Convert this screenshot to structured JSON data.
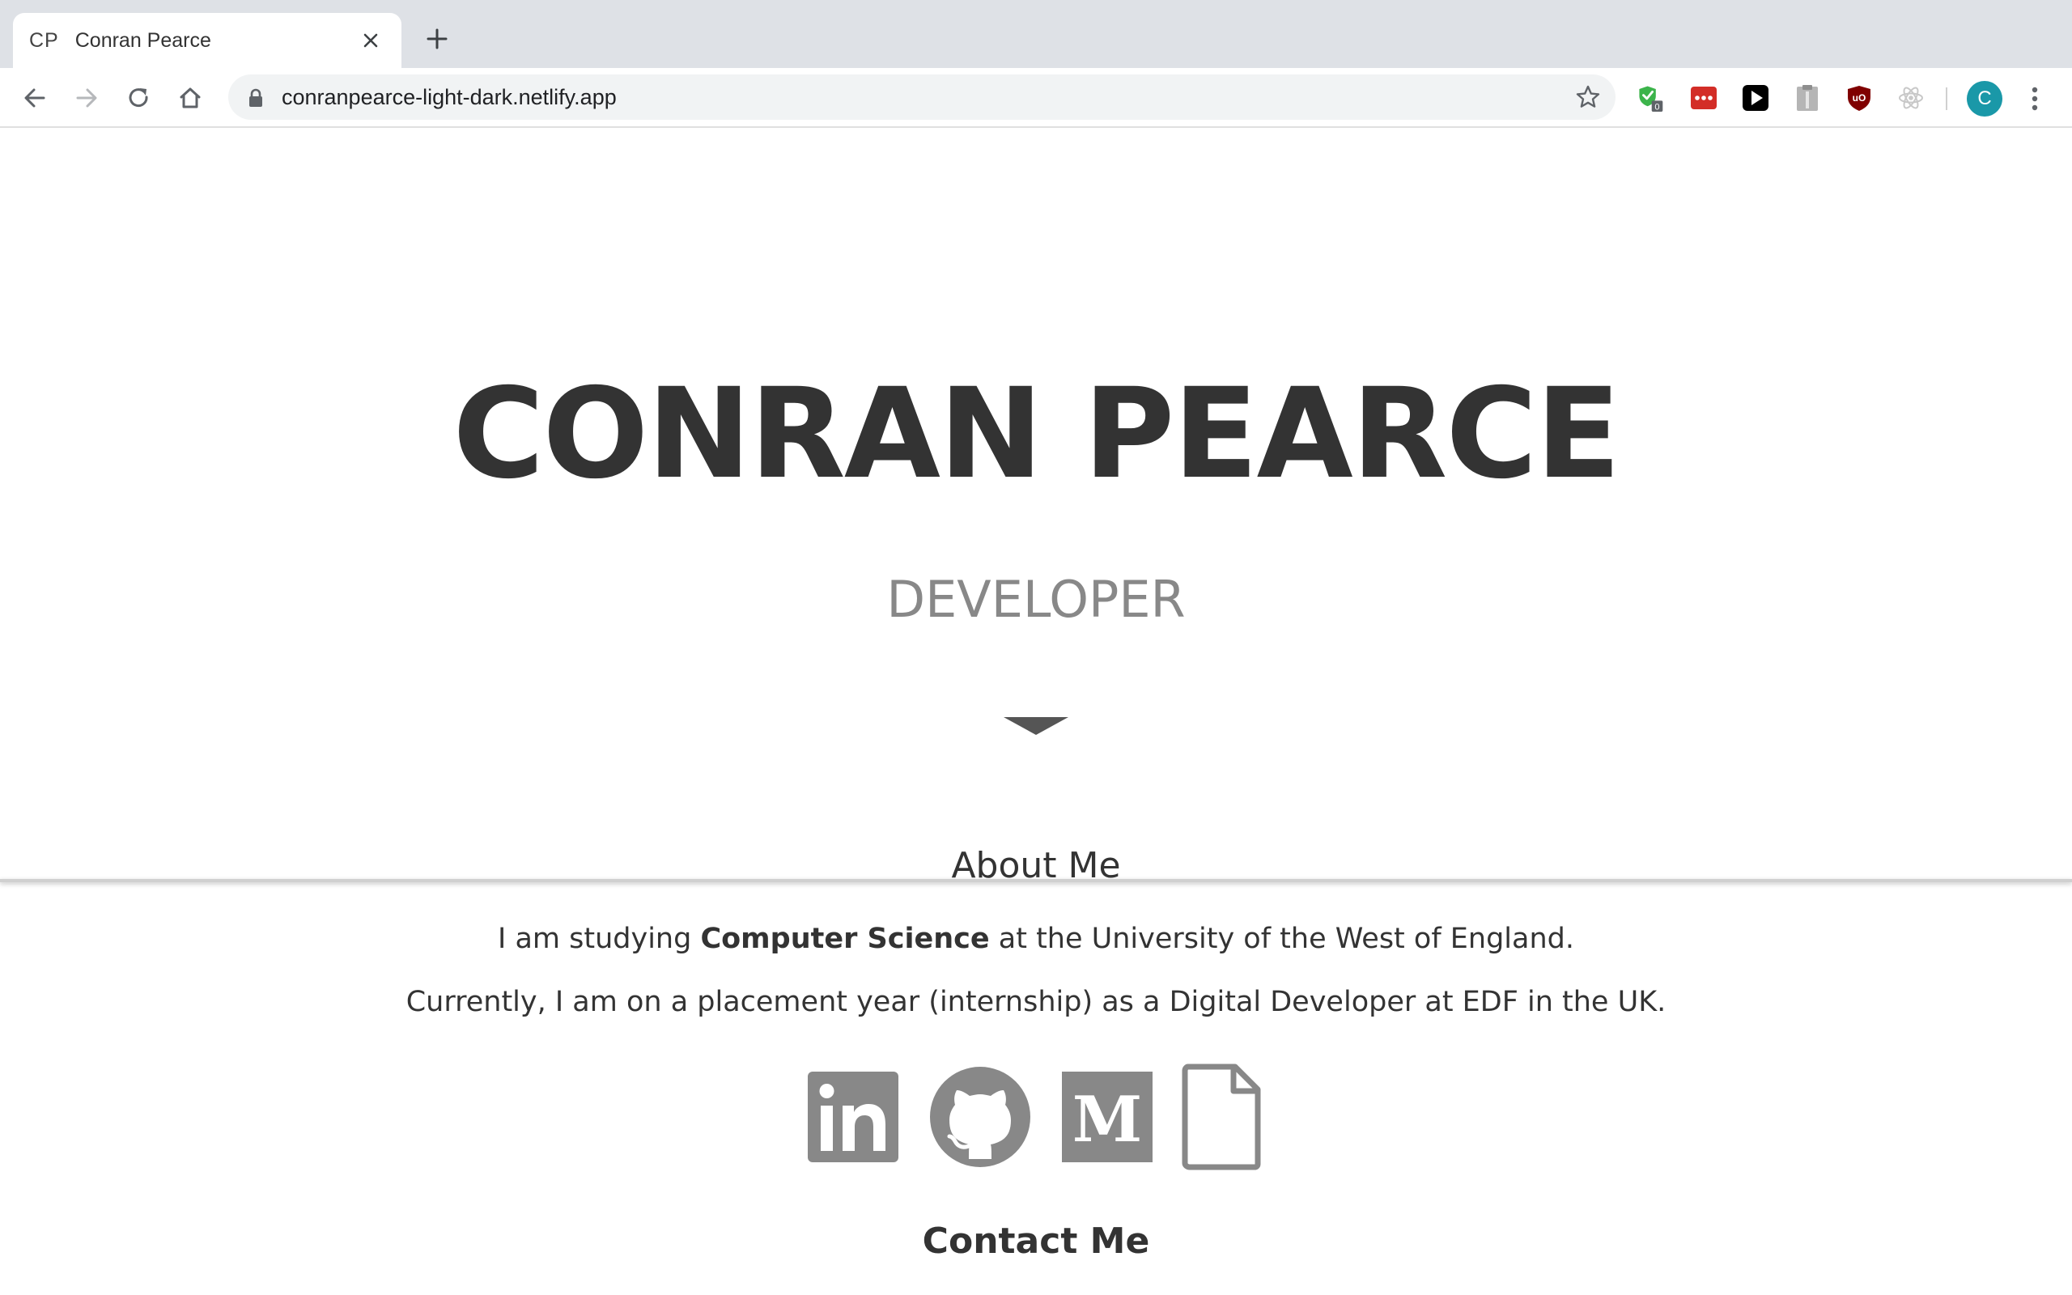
{
  "browser": {
    "tab": {
      "favicon_text": "CP",
      "title": "Conran Pearce"
    },
    "address_bar": {
      "url": "conranpearce-light-dark.netlify.app"
    },
    "extensions": [
      {
        "name": "adguard-extension-icon",
        "badge": "0",
        "color": "#3cb44b"
      },
      {
        "name": "lastpass-extension-icon",
        "color": "#d32d27"
      },
      {
        "name": "play-extension-icon",
        "color": "#000000"
      },
      {
        "name": "clipboard-extension-icon",
        "color": "#9e9e9e"
      },
      {
        "name": "ublock-extension-icon",
        "color": "#800000"
      },
      {
        "name": "react-devtools-extension-icon",
        "color": "#c8c8c8"
      }
    ],
    "profile": {
      "initial": "C",
      "color": "#1a98a8"
    }
  },
  "hero": {
    "name": "CONRAN PEARCE",
    "role": "DEVELOPER"
  },
  "about": {
    "heading": "About Me",
    "line1_before": "I am studying ",
    "line1_emph": "Computer Science",
    "line1_after": " at the University of the West of England.",
    "line2": "Currently, I am on a placement year (internship) as a Digital Developer at EDF in the UK."
  },
  "social": {
    "icons": [
      "linkedin-icon",
      "github-icon",
      "medium-icon",
      "document-icon"
    ],
    "icon_color": "#888888",
    "medium_letter": "M"
  },
  "contact": {
    "heading": "Contact Me"
  }
}
